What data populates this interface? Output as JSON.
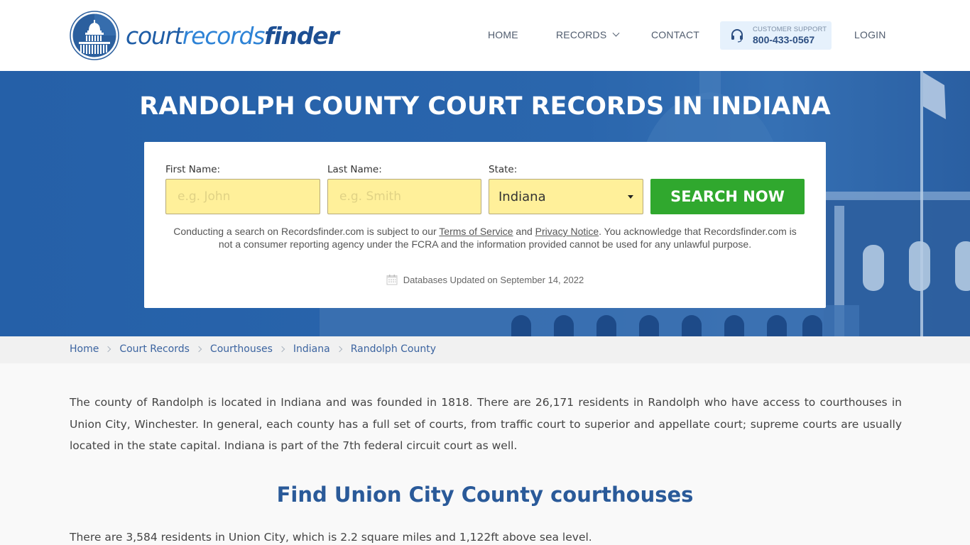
{
  "header": {
    "logo": {
      "part1": "court",
      "part2": "records",
      "part3": "finder",
      "icon": "capitol-dome-icon"
    },
    "nav": {
      "home": "HOME",
      "records": "RECORDS",
      "contact": "CONTACT",
      "login": "LOGIN"
    },
    "support": {
      "label": "CUSTOMER SUPPORT",
      "phone": "800-433-0567",
      "icon": "headset-icon"
    }
  },
  "hero": {
    "title": "RANDOLPH COUNTY COURT RECORDS IN INDIANA",
    "form": {
      "first_name_label": "First Name:",
      "first_name_placeholder": "e.g. John",
      "first_name_value": "",
      "last_name_label": "Last Name:",
      "last_name_placeholder": "e.g. Smith",
      "last_name_value": "",
      "state_label": "State:",
      "state_value": "Indiana",
      "search_button": "SEARCH NOW"
    },
    "disclaimer": {
      "before_terms": "Conducting a search on Recordsfinder.com is subject to our ",
      "terms_link": "Terms of Service",
      "between": " and ",
      "privacy_link": "Privacy Notice",
      "after": ". You acknowledge that Recordsfinder.com is not a consumer reporting agency under the FCRA and the information provided cannot be used for any unlawful purpose."
    },
    "updated": "Databases Updated on September 14, 2022"
  },
  "breadcrumb": [
    "Home",
    "Court Records",
    "Courthouses",
    "Indiana",
    "Randolph County"
  ],
  "content": {
    "intro": "The county of Randolph is located in Indiana and was founded in 1818. There are 26,171 residents in Randolph who have access to courthouses in Union City, Winchester. In general, each county has a full set of courts, from traffic court to superior and appellate court; supreme courts are usually located in the state capital. Indiana is part of the 7th federal circuit court as well.",
    "section_title": "Find Union City County courthouses",
    "section_para": "There are 3,584 residents in Union City, which is 2.2 square miles and 1,122ft above sea level."
  },
  "colors": {
    "brand_blue": "#2560a8",
    "search_green": "#30a82e",
    "field_yellow": "#fff09a",
    "heading_blue": "#2a5a99"
  }
}
